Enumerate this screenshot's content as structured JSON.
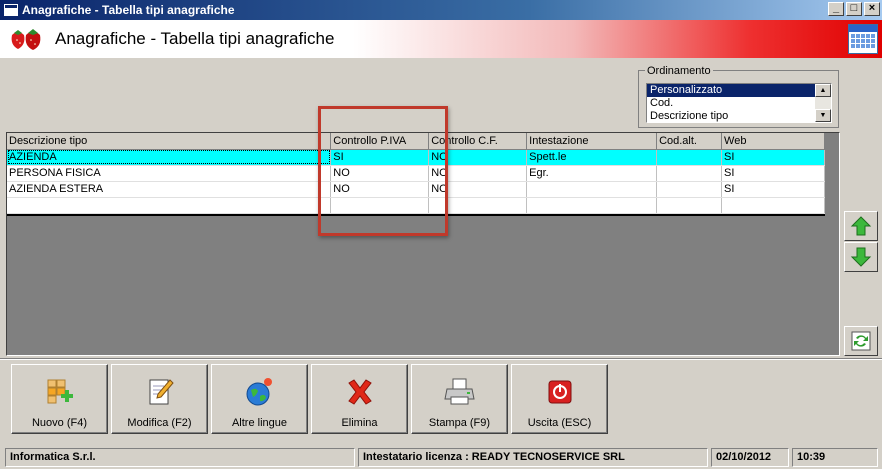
{
  "window": {
    "title": "Anagrafiche - Tabella tipi anagrafiche",
    "controls": [
      "_",
      "□",
      "×"
    ]
  },
  "header": {
    "title": "Anagrafiche - Tabella tipi anagrafiche",
    "logo_icon": "strawberries-icon",
    "right_icon": "calendar-grid-icon"
  },
  "ordering": {
    "legend": "Ordinamento",
    "options": [
      "Personalizzato",
      "Cod.",
      "Descrizione tipo"
    ],
    "selected_index": 0
  },
  "grid": {
    "columns": [
      "Descrizione tipo",
      "Controllo P.IVA",
      "Controllo C.F.",
      "Intestazione",
      "Cod.alt.",
      "Web"
    ],
    "rows": [
      [
        "AZIENDA",
        "SI",
        "NO",
        "Spett.le",
        "",
        "SI"
      ],
      [
        "PERSONA FISICA",
        "NO",
        "NO",
        "Egr.",
        "",
        "SI"
      ],
      [
        "AZIENDA ESTERA",
        "NO",
        "NO",
        "",
        "",
        "SI"
      ]
    ],
    "selected_row": 0
  },
  "side_buttons": [
    "arrow-up-icon",
    "arrow-down-icon",
    "refresh-icon"
  ],
  "toolbar": {
    "new": "Nuovo (F4)",
    "edit": "Modifica (F2)",
    "languages": "Altre lingue",
    "delete": "Elimina",
    "print": "Stampa (F9)",
    "exit": "Uscita (ESC)"
  },
  "status": {
    "company": "Informatica S.r.l.",
    "license": "Intestatario licenza : READY TECNOSERVICE SRL",
    "date": "02/10/2012",
    "time": "10:39"
  },
  "colors": {
    "selection": "#00ffff",
    "highlight": "#c0392b",
    "title_bar": "#0a246a"
  }
}
